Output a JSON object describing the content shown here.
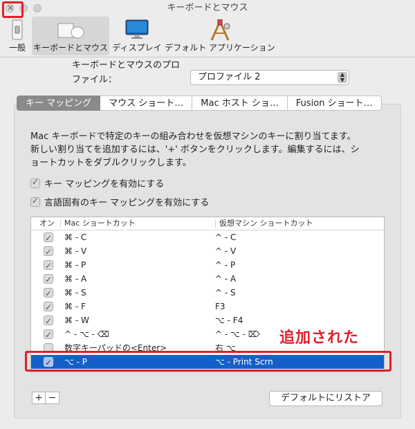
{
  "window": {
    "title": "キーボードとマウス"
  },
  "toolbar": {
    "items": [
      {
        "label": "一般",
        "icon": "general-switch-icon"
      },
      {
        "label": "キーボードとマウス",
        "icon": "keyboard-mouse-icon",
        "selected": true
      },
      {
        "label": "ディスプレイ",
        "icon": "display-icon"
      },
      {
        "label": "デフォルト アプリケーション",
        "icon": "default-applications-icon"
      }
    ]
  },
  "profile": {
    "heading": "キーボードとマウスのプロ",
    "label": "ファイル：",
    "selected": "プロファイル 2"
  },
  "tabs": [
    {
      "label": "キー マッピング",
      "active": true
    },
    {
      "label": "マウス ショート…"
    },
    {
      "label": "Mac ホスト ショ…"
    },
    {
      "label": "Fusion ショート…"
    }
  ],
  "description": [
    "Mac キーボードで特定のキーの組み合わせを仮想マシンのキーに割り当てます。",
    "新しい割り当てを追加するには、'+' ボタンをクリックします。編集するには、シ",
    "ョートカットをダブルクリックします。"
  ],
  "options": {
    "enable_key_mapping": "キー マッピングを有効にする",
    "enable_language_mapping": "言語固有のキー マッピングを有効にする"
  },
  "table": {
    "headers": {
      "on": "オン",
      "mac": "Mac ショートカット",
      "vm": "仮想マシン ショートカット"
    },
    "rows": [
      {
        "mac": "⌘ - C",
        "vm": "^ - C",
        "on": true
      },
      {
        "mac": "⌘ - V",
        "vm": "^ - V",
        "on": true
      },
      {
        "mac": "⌘ - P",
        "vm": "^ - P",
        "on": true
      },
      {
        "mac": "⌘ - A",
        "vm": "^ - A",
        "on": true
      },
      {
        "mac": "⌘ - S",
        "vm": "^ - S",
        "on": true
      },
      {
        "mac": "⌘ - F",
        "vm": "F3",
        "on": true
      },
      {
        "mac": "⌘ - W",
        "vm": "⌥ - F4",
        "on": true
      },
      {
        "mac": "^ - ⌥ - ⌫",
        "vm": "^ - ⌥ - ⌦",
        "on": true
      },
      {
        "mac": "数字キーパッドの<Enter>",
        "vm": "右 ⌥",
        "on": false
      },
      {
        "mac": "⌥ - P",
        "vm": "⌥ - Print Scrn",
        "on": true,
        "selected": true
      }
    ]
  },
  "annotation": "追加された",
  "buttons": {
    "add": "+",
    "remove": "−",
    "restore": "デフォルトにリストア"
  },
  "colors": {
    "accent": "#1560c8",
    "annotation": "#e0202a"
  }
}
